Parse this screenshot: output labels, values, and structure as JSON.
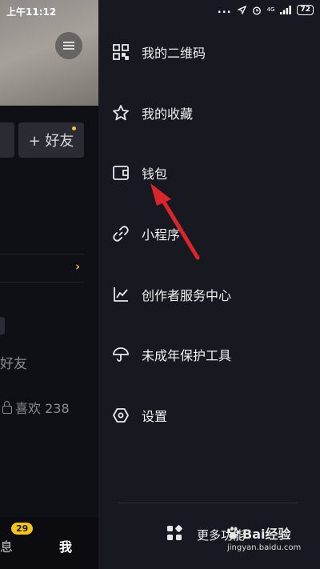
{
  "status_bar": {
    "time": "上午11:12",
    "dots": "...",
    "network": "4G",
    "battery": "72"
  },
  "background_page": {
    "add_friend_label": "+ 好友",
    "friend_text": "好友",
    "likes_text": "喜欢 238",
    "chevron": "›",
    "bottom_nav": {
      "messages_label": "息",
      "messages_badge": "29",
      "me_label": "我"
    }
  },
  "drawer": {
    "items": [
      {
        "label": "我的二维码",
        "icon": "qrcode-icon"
      },
      {
        "label": "我的收藏",
        "icon": "star-icon"
      },
      {
        "label": "钱包",
        "icon": "wallet-icon"
      },
      {
        "label": "小程序",
        "icon": "link-icon"
      },
      {
        "label": "创作者服务中心",
        "icon": "chart-icon"
      },
      {
        "label": "未成年保护工具",
        "icon": "umbrella-icon"
      },
      {
        "label": "设置",
        "icon": "settings-hexagon-icon"
      }
    ],
    "more_label": "更多功能"
  },
  "annotation": {
    "color": "#d8262b"
  },
  "watermark": {
    "brand": "Bai经验",
    "url": "jingyan.baidu.com"
  }
}
